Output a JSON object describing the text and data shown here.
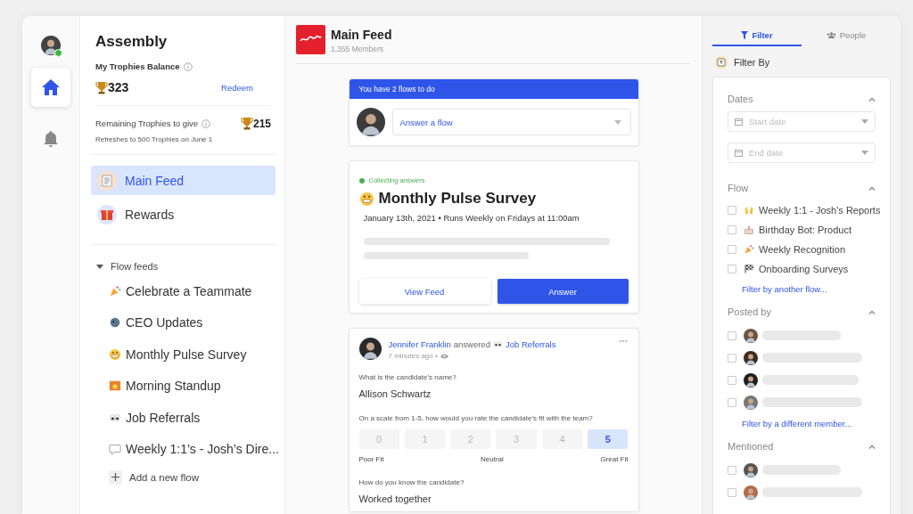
{
  "rail": {
    "avatar": {
      "online": true
    },
    "items": [
      {
        "kind": "home",
        "selected": true
      },
      {
        "kind": "bell",
        "selected": false
      }
    ]
  },
  "sidebar": {
    "title": "Assembly",
    "balance": {
      "label": "My Trophies Balance",
      "value": "323",
      "action": "Redeem"
    },
    "remaining": {
      "label": "Remaining Trophies to give",
      "value": "215",
      "note": "Refreshes to 500 Trophies on June 1"
    },
    "nav": [
      {
        "label": "Main Feed",
        "selected": true
      },
      {
        "label": "Rewards",
        "selected": false
      }
    ],
    "flow_feeds": {
      "label": "Flow feeds",
      "expanded": true,
      "items": [
        {
          "label": "Celebrate a Teammate"
        },
        {
          "label": "CEO Updates"
        },
        {
          "label": "Monthly Pulse Survey"
        },
        {
          "label": "Morning Standup"
        },
        {
          "label": "Job Referrals"
        },
        {
          "label": "Weekly 1:1’s - Josh’s Dire..."
        }
      ],
      "add": "Add a new flow"
    }
  },
  "feed": {
    "title": "Main Feed",
    "members": "1,355 Members",
    "todo": {
      "banner": "You have 2 flows to do",
      "select": "Answer a flow"
    },
    "survey": {
      "status": "Collecting answers",
      "title": "Monthly Pulse Survey",
      "subtitle": "January 13th, 2021 • Runs Weekly on Fridays at 11:00am",
      "buttons": [
        {
          "label": "View Feed",
          "kind": "secondary"
        },
        {
          "label": "Answer",
          "kind": "primary"
        }
      ]
    },
    "post": {
      "author": "Jennifer Franklin",
      "action": "answered",
      "flow": "Job Referrals",
      "time": "7 minutes ago •",
      "more": "•••",
      "answers": [
        {
          "kind": "text",
          "question": "What is the candidate’s name?",
          "answer": "Allison Schwartz"
        },
        {
          "kind": "scale",
          "question": "On a scale from 1-5, how would you rate the candidate’s fit with the team?",
          "options": [
            {
              "label": "0",
              "selected": false
            },
            {
              "label": "1",
              "selected": false
            },
            {
              "label": "2",
              "selected": false
            },
            {
              "label": "3",
              "selected": false
            },
            {
              "label": "4",
              "selected": false
            },
            {
              "label": "5",
              "selected": true
            }
          ],
          "scale_labels": [
            "Poor Fit",
            "Neutral",
            "Great Fit"
          ]
        },
        {
          "kind": "text",
          "question": "How do you know the candidate?",
          "answer": "Worked together"
        }
      ]
    }
  },
  "filters": {
    "tabs": [
      {
        "label": "Filter",
        "selected": true
      },
      {
        "label": "People",
        "selected": false
      }
    ],
    "heading": "Filter By",
    "sections": [
      {
        "kind": "dates",
        "title": "Dates",
        "expanded": true,
        "fields": [
          {
            "placeholder": "Start date"
          },
          {
            "placeholder": "End date"
          }
        ]
      },
      {
        "kind": "flows",
        "title": "Flow",
        "expanded": true,
        "items": [
          {
            "label": "Weekly 1:1 - Josh's Reports",
            "checked": false
          },
          {
            "label": "Birthday Bot: Product",
            "checked": false
          },
          {
            "label": "Weekly Recognition",
            "checked": false
          },
          {
            "label": "Onboarding Surveys",
            "checked": false
          }
        ],
        "link": "Filter by another flow..."
      },
      {
        "kind": "members",
        "title": "Posted by",
        "expanded": true,
        "items": [
          {
            "checked": false
          },
          {
            "checked": false
          },
          {
            "checked": false
          },
          {
            "checked": false
          }
        ],
        "link": "Filter by a different member..."
      },
      {
        "kind": "members",
        "title": "Mentioned",
        "expanded": true,
        "items": [
          {
            "checked": false
          },
          {
            "checked": false
          }
        ]
      }
    ]
  }
}
